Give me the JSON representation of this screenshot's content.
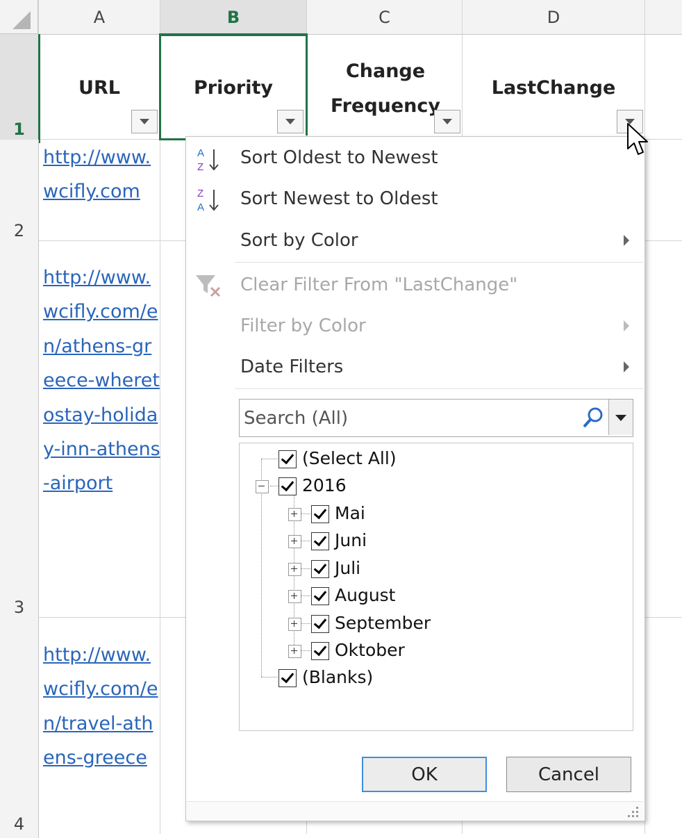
{
  "sheet": {
    "columns": [
      "A",
      "B",
      "C",
      "D"
    ],
    "rows": [
      "1",
      "2",
      "3",
      "4"
    ],
    "headers": [
      "URL",
      "Priority",
      "Change Frequency",
      "LastChange"
    ],
    "cells": {
      "a2": "http://www.wcifly.com",
      "a3": "http://www.wcifly.com/en/athens-greece-wheretostay-holiday-inn-athens-airport",
      "a4": "http://www.wcifly.com/en/travel-athens-greece"
    }
  },
  "menu": {
    "sort_asc": "Sort Oldest to Newest",
    "sort_desc": "Sort Newest to Oldest",
    "sort_color": "Sort by Color",
    "clear_filter": "Clear Filter From \"LastChange\"",
    "filter_color": "Filter by Color",
    "date_filters": "Date Filters",
    "search_placeholder": "Search (All)",
    "tree": {
      "select_all": "(Select All)",
      "year": "2016",
      "months": [
        "Mai",
        "Juni",
        "Juli",
        "August",
        "September",
        "Oktober"
      ],
      "blanks": "(Blanks)"
    },
    "ok": "OK",
    "cancel": "Cancel"
  },
  "icons": [
    "sort-az-icon",
    "sort-za-icon",
    "clear-filter-icon",
    "search-icon",
    "mouse-cursor-icon"
  ],
  "colors": {
    "selection": "#217346",
    "link": "#2a65b9",
    "ok_border": "#3d8ede"
  }
}
